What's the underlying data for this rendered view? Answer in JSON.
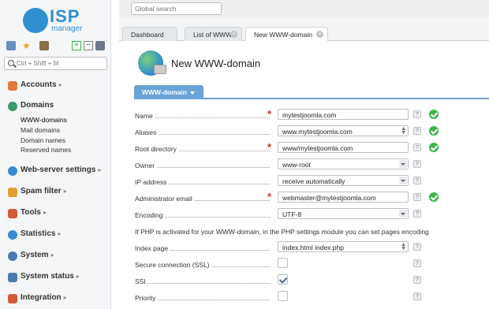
{
  "app": {
    "logo_primary": "ISP",
    "logo_secondary": "manager"
  },
  "sidebar": {
    "search_placeholder": "Ctrl + Shift + M",
    "toolbar_icons": [
      "app-grid-icon",
      "favorites-star-icon",
      "briefcase-icon",
      "expand-plus-icon",
      "collapse-minus-icon",
      "pin-icon"
    ],
    "groups": [
      {
        "label": "Accounts",
        "arrow": "▸",
        "icon": "users-icon",
        "color": "#e07a3a"
      },
      {
        "label": "Domains",
        "arrow": "",
        "icon": "globe-icon",
        "color": "#3a9a6a"
      },
      {
        "label": "Web-server settings",
        "arrow": "▸",
        "icon": "web-settings-icon",
        "color": "#3a8ad0"
      },
      {
        "label": "Spam filter",
        "arrow": "▸",
        "icon": "spam-filter-icon",
        "color": "#e0a030"
      },
      {
        "label": "Tools",
        "arrow": "▸",
        "icon": "tools-icon",
        "color": "#d05a3a"
      },
      {
        "label": "Statistics",
        "arrow": "▸",
        "icon": "statistics-icon",
        "color": "#3a8ad0"
      },
      {
        "label": "System",
        "arrow": "▸",
        "icon": "system-gear-icon",
        "color": "#4a7ab0"
      },
      {
        "label": "System status",
        "arrow": "▸",
        "icon": "monitor-icon",
        "color": "#4a7ab0"
      },
      {
        "label": "Integration",
        "arrow": "▸",
        "icon": "integration-icon",
        "color": "#d05a3a"
      }
    ],
    "domain_items": [
      "WWW-domains",
      "Mail domains",
      "Domain names",
      "Reserved names"
    ]
  },
  "topbar": {
    "search_placeholder": "Global search"
  },
  "tabs": [
    {
      "label": "Dashboard",
      "active": false,
      "closable": false
    },
    {
      "label": "List of WWW...",
      "active": false,
      "closable": true
    },
    {
      "label": "New WWW-domain",
      "active": true,
      "closable": true
    }
  ],
  "page": {
    "title": "New WWW-domain",
    "form_tab": "WWW-domain"
  },
  "form": {
    "rows": [
      {
        "label": "Name",
        "value": "mytestjoomla.com",
        "required": true,
        "valid": true,
        "kind": "text"
      },
      {
        "label": "Aliases",
        "value": "www.mytestjoomla.com",
        "required": false,
        "valid": true,
        "kind": "multiline"
      },
      {
        "label": "Root directory",
        "value": "www/mytestjoomla.com",
        "required": true,
        "valid": true,
        "kind": "text"
      },
      {
        "label": "Owner",
        "value": "www-root",
        "required": false,
        "valid": false,
        "kind": "select"
      },
      {
        "label": "IP address",
        "value": "receive automatically",
        "required": false,
        "valid": false,
        "kind": "select"
      },
      {
        "label": "Administrator email",
        "value": "webmaster@mytestjoomla.com",
        "required": true,
        "valid": true,
        "kind": "text"
      },
      {
        "label": "Encoding",
        "value": "UTF-8",
        "required": false,
        "valid": false,
        "kind": "select"
      }
    ],
    "note": "If PHP is activated for your WWW-domain, in the PHP settings module you can set pages encoding",
    "rows2": [
      {
        "label": "Index page",
        "value": "index.html index.php",
        "kind": "multiline"
      },
      {
        "label": "Secure connection (SSL)",
        "checked": false,
        "kind": "checkbox"
      },
      {
        "label": "SSI",
        "checked": true,
        "kind": "checkbox"
      },
      {
        "label": "Priority",
        "checked": false,
        "kind": "checkbox"
      }
    ],
    "help_glyph": "?"
  },
  "colors": {
    "accent": "#6aa4d8",
    "brand": "#2f8fcf",
    "required": "#d93030",
    "valid": "#3cb54a"
  }
}
